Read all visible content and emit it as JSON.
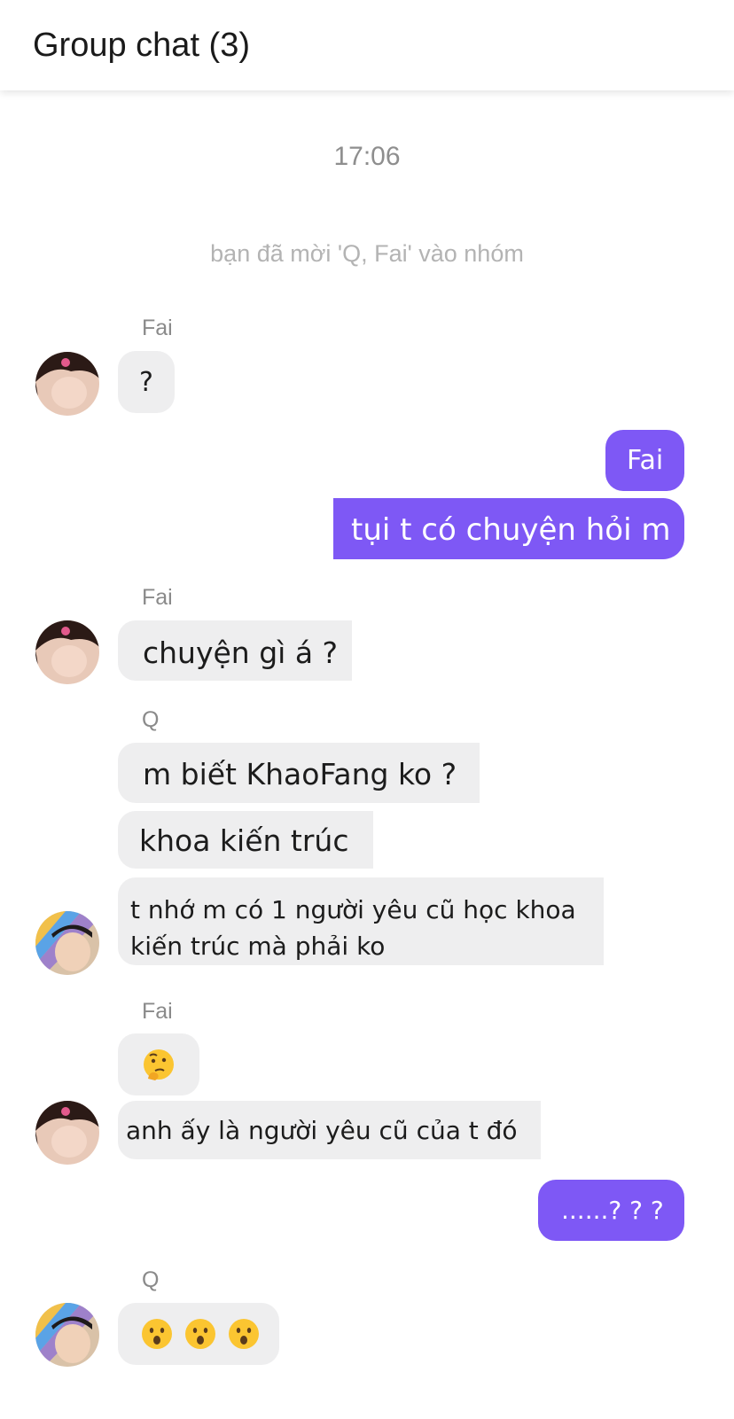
{
  "header": {
    "title": "Group chat (3)"
  },
  "conversation": {
    "timestamp": "17:06",
    "system_notice": "bạn đã mời 'Q, Fai' vào nhóm"
  },
  "messages": {
    "m1": {
      "sender": "Fai",
      "text": "?"
    },
    "m2": {
      "text": "Fai"
    },
    "m3": {
      "text": "tụi t có chuyện hỏi m"
    },
    "m4": {
      "sender": "Fai",
      "text": "chuyện gì á ?"
    },
    "m5": {
      "sender": "Q",
      "text": "m biết KhaoFang ko ?"
    },
    "m6": {
      "text": "khoa kiến trúc"
    },
    "m7": {
      "text_line1": "t nhớ m có 1 người yêu cũ học khoa",
      "text_line2": "kiến trúc mà phải ko"
    },
    "m8": {
      "sender": "Fai",
      "emoji": "thinking-face-emoji"
    },
    "m9": {
      "text": "anh ấy là người yêu cũ của t đó"
    },
    "m10": {
      "text": "......? ? ?"
    },
    "m11": {
      "sender": "Q",
      "emoji": [
        "hushed-face-emoji",
        "hushed-face-emoji",
        "hushed-face-emoji"
      ]
    }
  },
  "colors": {
    "outgoing_bubble": "#7e58f5",
    "incoming_bubble": "#eeeeef",
    "sender_label": "#8a8a8a"
  }
}
